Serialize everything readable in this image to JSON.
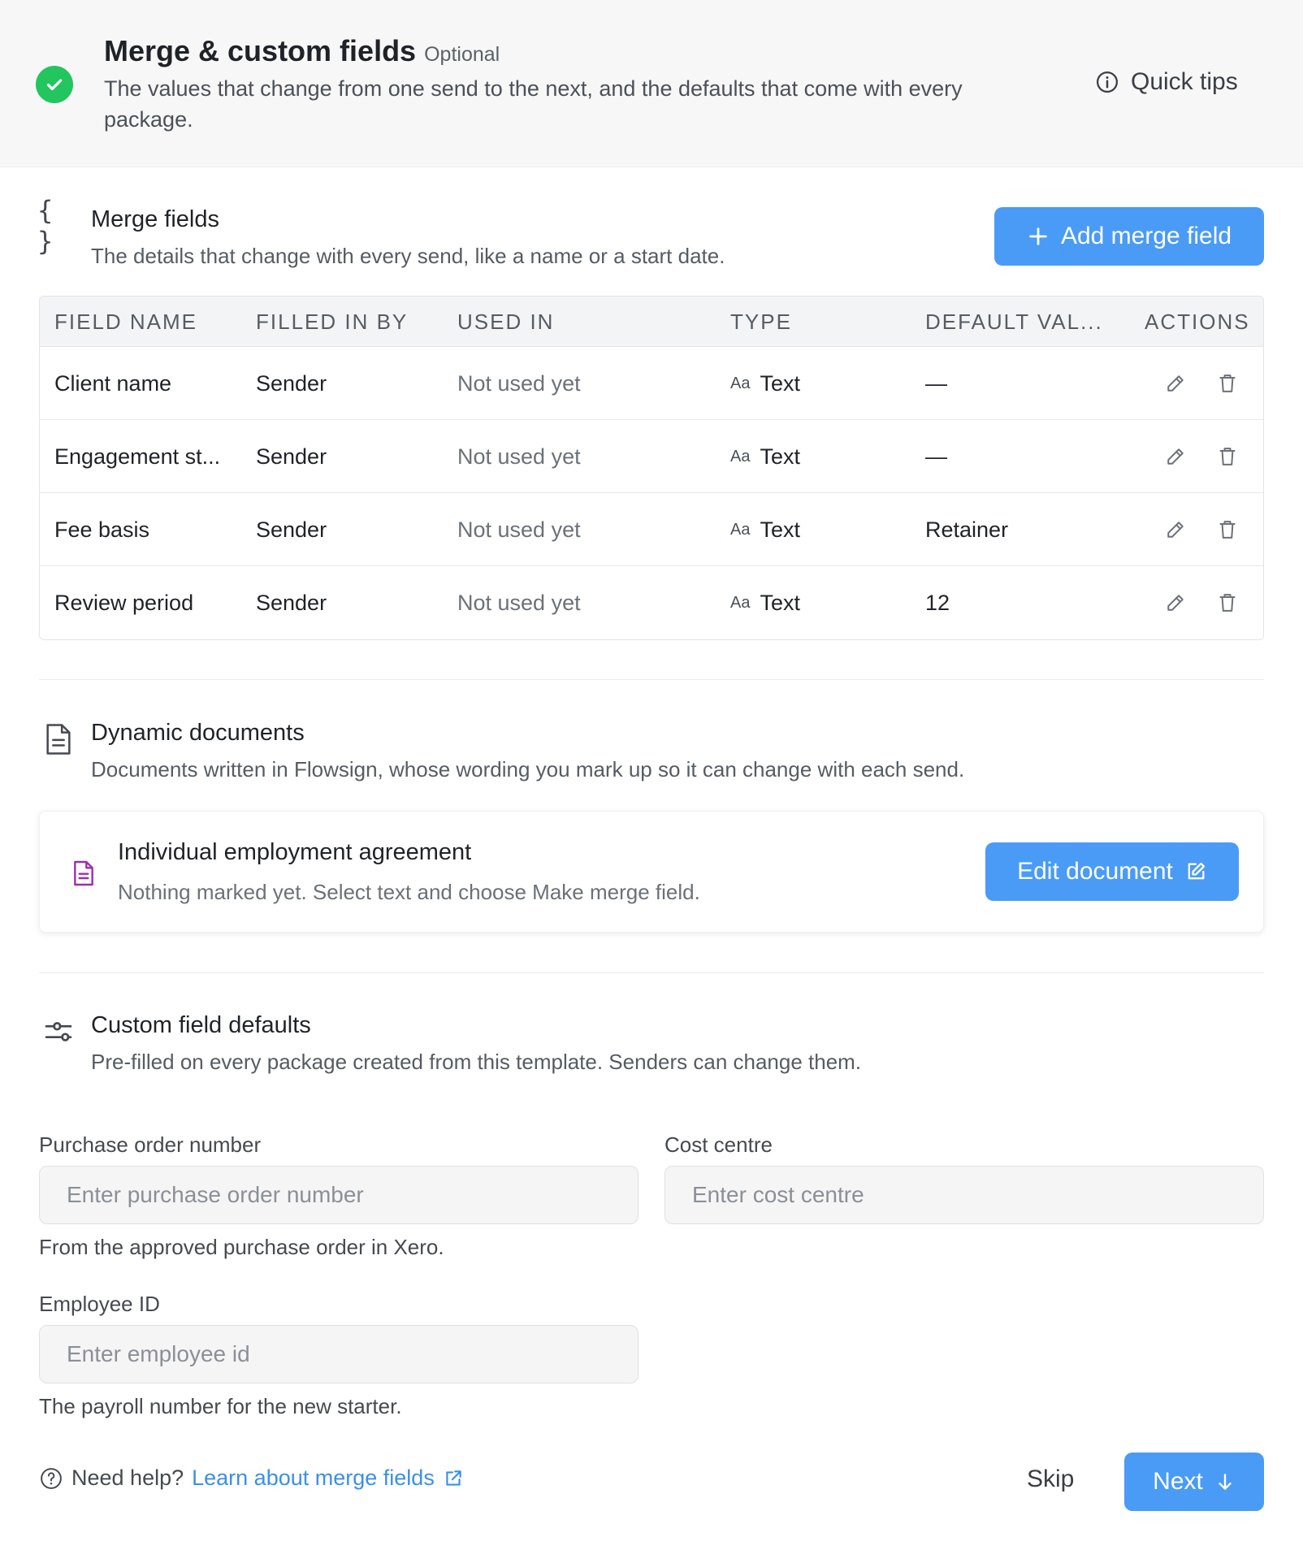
{
  "header": {
    "title": "Merge & custom fields",
    "optional": "Optional",
    "description": "The values that change from one send to the next, and the defaults that come with every package.",
    "quick_tips": "Quick tips",
    "status_color": "#22c55e"
  },
  "merge_fields": {
    "title": "Merge fields",
    "description": "The details that change with every send, like a name or a start date.",
    "add_button": "Add merge field",
    "columns": [
      "FIELD NAME",
      "FILLED IN BY",
      "USED IN",
      "TYPE",
      "DEFAULT VAL...",
      "ACTIONS"
    ],
    "rows": [
      {
        "name": "Client name",
        "filled_by": "Sender",
        "used_in": "Not used yet",
        "type_icon": "Aa",
        "type": "Text",
        "default": "—"
      },
      {
        "name": "Engagement st...",
        "filled_by": "Sender",
        "used_in": "Not used yet",
        "type_icon": "Aa",
        "type": "Text",
        "default": "—"
      },
      {
        "name": "Fee basis",
        "filled_by": "Sender",
        "used_in": "Not used yet",
        "type_icon": "Aa",
        "type": "Text",
        "default": "Retainer"
      },
      {
        "name": "Review period",
        "filled_by": "Sender",
        "used_in": "Not used yet",
        "type_icon": "Aa",
        "type": "Text",
        "default": "12"
      }
    ]
  },
  "dynamic_docs": {
    "title": "Dynamic documents",
    "description": "Documents written in Flowsign, whose wording you mark up so it can change with each send.",
    "document": {
      "title": "Individual employment agreement",
      "description": "Nothing marked yet. Select text and choose Make merge field.",
      "edit_button": "Edit document",
      "icon_color": "#9b2fae"
    }
  },
  "custom_defaults": {
    "title": "Custom field defaults",
    "description": "Pre-filled on every package created from this template. Senders can change them.",
    "fields": {
      "po_number": {
        "label": "Purchase order number",
        "placeholder": "Enter purchase order number",
        "value": "",
        "help": "From the approved purchase order in Xero."
      },
      "cost_centre": {
        "label": "Cost centre",
        "placeholder": "Enter cost centre",
        "value": ""
      },
      "employee_id": {
        "label": "Employee ID",
        "placeholder": "Enter employee id",
        "value": "",
        "help": "The payroll number for the new starter."
      }
    }
  },
  "footer": {
    "need_help": "Need help?",
    "link": "Learn about merge fields",
    "skip": "Skip",
    "next": "Next"
  },
  "colors": {
    "primary": "#4a9bf5",
    "link": "#3b8fe8"
  }
}
